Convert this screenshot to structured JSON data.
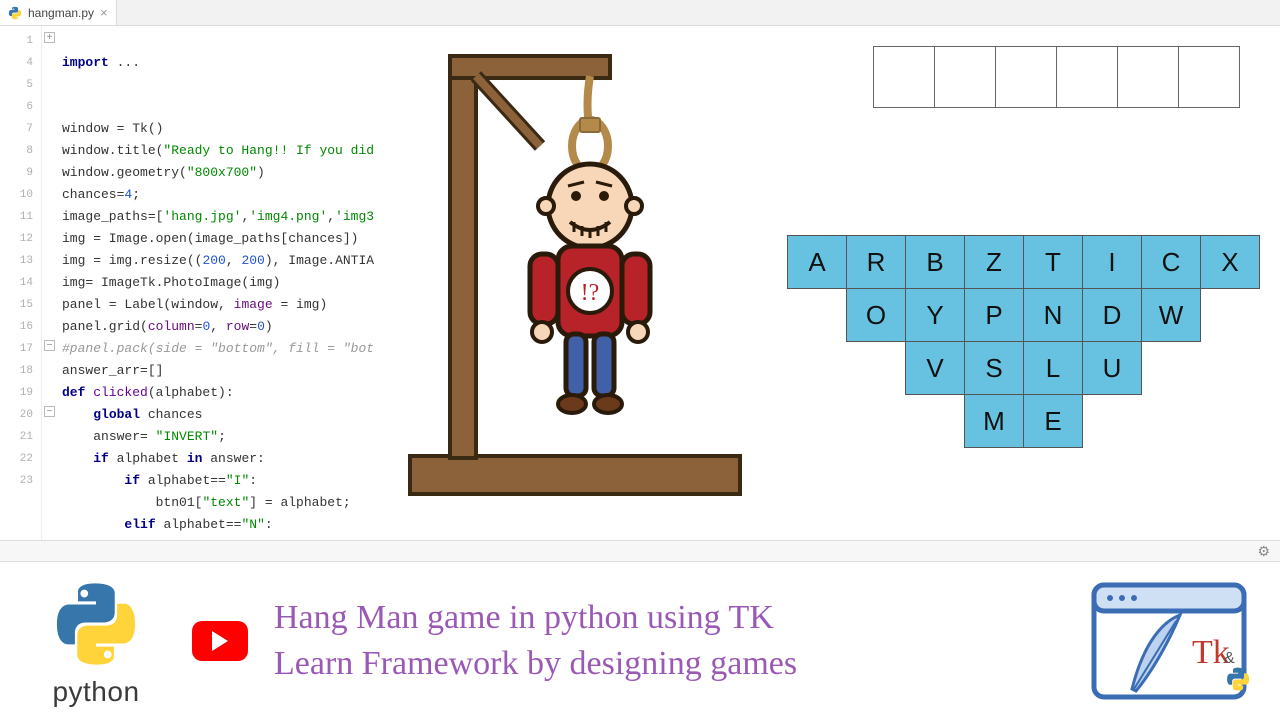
{
  "tab": {
    "filename": "hangman.py",
    "close": "×"
  },
  "gutter": [
    "1",
    "4",
    "5",
    "6",
    "7",
    "8",
    "9",
    "10",
    "11",
    "12",
    "13",
    "14",
    "15",
    "16",
    "17",
    "18",
    "19",
    "20",
    "21",
    "22",
    "23"
  ],
  "code": {
    "l1_kw": "import",
    "l1_rest": " ...",
    "l5": "window = Tk()",
    "l6a": "window.title(",
    "l6s": "\"Ready to Hang!! If you did",
    "l7a": "window.geometry(",
    "l7s": "\"800x700\"",
    "l7b": ")",
    "l8a": "chances=",
    "l8n": "4",
    "l8b": ";",
    "l9a": "image_paths=[",
    "l9s1": "'hang.jpg'",
    "l9c1": ",",
    "l9s2": "'img4.png'",
    "l9c2": ",",
    "l9s3": "'img3",
    "l10": "img = Image.open(image_paths[chances])",
    "l11a": "img = img.resize((",
    "l11n1": "200",
    "l11c": ", ",
    "l11n2": "200",
    "l11b": "), Image.ANTIA",
    "l12": "img= ImageTk.PhotoImage(img)",
    "l13a": "panel = Label(window, ",
    "l13attr": "image",
    "l13b": " = img)",
    "l14a": "panel.grid(",
    "l14attr1": "column",
    "l14b": "=",
    "l14n1": "0",
    "l14c": ", ",
    "l14attr2": "row",
    "l14d": "=",
    "l14n2": "0",
    "l14e": ")",
    "l15": "#panel.pack(side = \"bottom\", fill = \"bot",
    "l16": "answer_arr=[]",
    "l17_kw": "def",
    "l17_fn": " clicked",
    "l17_rest": "(alphabet):",
    "l18_kw": "global",
    "l18_rest": " chances",
    "l19a": "answer= ",
    "l19s": "\"INVERT\"",
    "l19b": ";",
    "l20_kw": "if",
    "l20_rest": " alphabet ",
    "l20_kw2": "in",
    "l20_rest2": " answer:",
    "l21_kw": "if",
    "l21_rest": " alphabet==",
    "l21s": "\"I\"",
    "l21b": ":",
    "l22a": "btn01[",
    "l22s": "\"text\"",
    "l22b": "] = alphabet;",
    "l23_kw": "elif",
    "l23_rest": " alphabet==",
    "l23s": "\"N\"",
    "l23b": ":"
  },
  "answer_slots": 6,
  "letters": {
    "row1": [
      "A",
      "R",
      "B",
      "Z",
      "T",
      "I",
      "C",
      "X"
    ],
    "row2": [
      "O",
      "Y",
      "P",
      "N",
      "D",
      "W"
    ],
    "row3": [
      "V",
      "S",
      "L",
      "U"
    ],
    "row4": [
      "M",
      "E"
    ]
  },
  "banner": {
    "python_word": "python",
    "line1": "Hang Man game in python using TK",
    "line2": "Learn Framework by designing games",
    "tk_label": "Tk",
    "amp": "&"
  }
}
